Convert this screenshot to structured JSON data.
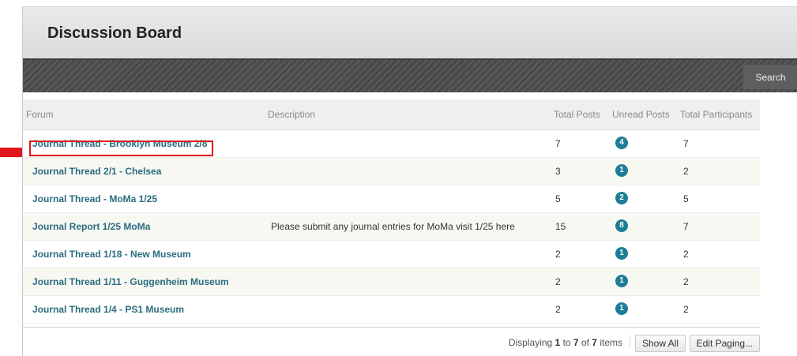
{
  "page": {
    "title": "Discussion Board"
  },
  "actionbar": {
    "search_label": "Search"
  },
  "table": {
    "headers": {
      "forum": "Forum",
      "description": "Description",
      "total_posts": "Total Posts",
      "unread_posts": "Unread Posts",
      "total_participants": "Total Participants"
    },
    "rows": [
      {
        "forum": "Journal Thread - Brooklyn Museum 2/8",
        "description": "",
        "total_posts": "7",
        "unread": "4",
        "participants": "7"
      },
      {
        "forum": "Journal Thread 2/1 - Chelsea",
        "description": "",
        "total_posts": "3",
        "unread": "1",
        "participants": "2"
      },
      {
        "forum": "Journal Thread - MoMa 1/25",
        "description": "",
        "total_posts": "5",
        "unread": "2",
        "participants": "5"
      },
      {
        "forum": "Journal Report 1/25 MoMa",
        "description": "Please submit any journal entries for MoMa visit 1/25 here",
        "total_posts": "15",
        "unread": "8",
        "participants": "7"
      },
      {
        "forum": "Journal Thread 1/18 - New Museum",
        "description": "",
        "total_posts": "2",
        "unread": "1",
        "participants": "2"
      },
      {
        "forum": "Journal Thread 1/11 - Guggenheim Museum",
        "description": "",
        "total_posts": "2",
        "unread": "1",
        "participants": "2"
      },
      {
        "forum": "Journal Thread 1/4 - PS1 Museum",
        "description": "",
        "total_posts": "2",
        "unread": "1",
        "participants": "2"
      }
    ]
  },
  "footer": {
    "displaying_prefix": "Displaying ",
    "from": "1",
    "to_word": " to ",
    "to": "7",
    "of_word": " of ",
    "total": "7",
    "items_word": " items",
    "show_all_label": "Show All",
    "edit_paging_label": "Edit Paging..."
  },
  "colors": {
    "badge": "#1e7d96",
    "link": "#2a6b7f",
    "highlight": "#e0181b"
  }
}
